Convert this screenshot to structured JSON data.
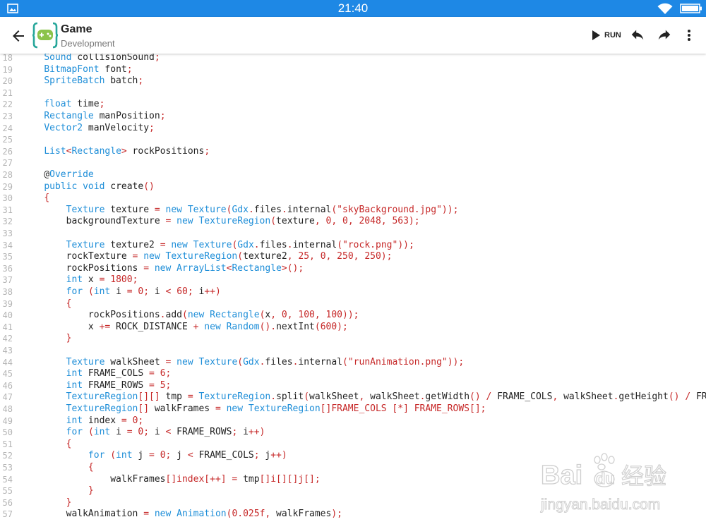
{
  "status_bar": {
    "time": "21:40",
    "color": "#1e88e5"
  },
  "app_bar": {
    "title": "Game",
    "subtitle": "Development",
    "run_label": "RUN",
    "icons": [
      "back-arrow-icon",
      "app-logo-icon",
      "play-icon",
      "undo-icon",
      "redo-icon",
      "more-vert-icon"
    ]
  },
  "colors": {
    "keyword": "#1e8ed8",
    "string": "#c62828",
    "number": "#c62828",
    "line_number": "#b4b4b4",
    "text": "#222222"
  },
  "editor": {
    "lines": [
      {
        "n": "18",
        "t": "    {Sound} collisionSound[;]"
      },
      {
        "n": "19",
        "t": "    {BitmapFont} font[;]"
      },
      {
        "n": "20",
        "t": "    {SpriteBatch} batch[;]"
      },
      {
        "n": "21",
        "t": ""
      },
      {
        "n": "22",
        "t": "    {float} time[;]"
      },
      {
        "n": "23",
        "t": "    {Rectangle} manPosition[;]"
      },
      {
        "n": "24",
        "t": "    {Vector2} manVelocity[;]"
      },
      {
        "n": "25",
        "t": ""
      },
      {
        "n": "26",
        "t": "    {List}[<]{Rectangle}[>] rockPositions[;]"
      },
      {
        "n": "27",
        "t": ""
      },
      {
        "n": "28",
        "t": "    @{Override}"
      },
      {
        "n": "29",
        "t": "    {public} {void} create[()]"
      },
      {
        "n": "30",
        "t": "    [{]"
      },
      {
        "n": "31",
        "t": "        {Texture} texture [=] {new} {Texture}[(]{Gdx}[.]files[.]internal[(]\"skyBackground.jpg\"[));]"
      },
      {
        "n": "32",
        "t": "        backgroundTexture [=] {new} {TextureRegion}[(]texture[,] <0>[,] <0>[,] <2048>[,] <563>[);]"
      },
      {
        "n": "33",
        "t": ""
      },
      {
        "n": "34",
        "t": "        {Texture} texture2 [=] {new} {Texture}[(]{Gdx}[.]files[.]internal[(]\"rock.png\"[));]"
      },
      {
        "n": "35",
        "t": "        rockTexture [=] {new} {TextureRegion}[(]texture2[,] <25>[,] <0>[,] <250>[,] <250>[);]"
      },
      {
        "n": "36",
        "t": "        rockPositions [=] {new} {ArrayList}[<]{Rectangle}[>();]"
      },
      {
        "n": "37",
        "t": "        {int} x [=] <1800>[;]"
      },
      {
        "n": "38",
        "t": "        {for} [(]{int} i [=] <0>[;] i [<] <60>[;] i[++)]"
      },
      {
        "n": "39",
        "t": "        [{]"
      },
      {
        "n": "40",
        "t": "            rockPositions[.]add[(]{new} {Rectangle}[(]x[,] <0>[,] <100>[,] <100>[));]"
      },
      {
        "n": "41",
        "t": "            x [+=] ROCK_DISTANCE [+] {new} {Random}[().]nextInt[(]<600>[);]"
      },
      {
        "n": "42",
        "t": "        [}]"
      },
      {
        "n": "43",
        "t": ""
      },
      {
        "n": "44",
        "t": "        {Texture} walkSheet [=] {new} {Texture}[(]{Gdx}[.]files[.]internal[(]\"runAnimation.png\"[));]"
      },
      {
        "n": "45",
        "t": "        {int} FRAME_COLS [=] <6>[;]"
      },
      {
        "n": "46",
        "t": "        {int} FRAME_ROWS [=] <5>[;]"
      },
      {
        "n": "47",
        "t": "        {TextureRegion}[[][]] tmp [=] {TextureRegion}[.]split[(]walkSheet[,] walkSheet[.]getWidth[()] [/] FRAME_COLS[,] walkSheet[.]getHeight[()] [/] FRAME_ROWS[);]"
      },
      {
        "n": "48",
        "t": "        {TextureRegion}[[]] walkFrames [=] {new} {TextureRegion}[[]FRAME_COLS [*] FRAME_ROWS[];]"
      },
      {
        "n": "49",
        "t": "        {int} index [=] <0>[;]"
      },
      {
        "n": "50",
        "t": "        {for} [(]{int} i [=] <0>[;] i [<] FRAME_ROWS[;] i[++)]"
      },
      {
        "n": "51",
        "t": "        [{]"
      },
      {
        "n": "52",
        "t": "            {for} [(]{int} j [=] <0>[;] j [<] FRAME_COLS[;] j[++)]"
      },
      {
        "n": "53",
        "t": "            [{]"
      },
      {
        "n": "54",
        "t": "                walkFrames[[]index[++]] [=] tmp[[]i[][]j[];]"
      },
      {
        "n": "55",
        "t": "            [}]"
      },
      {
        "n": "56",
        "t": "        [}]"
      },
      {
        "n": "57",
        "t": "        walkAnimation [=] {new} {Animation}[(]<0.025f>[,] walkFrames[);]"
      }
    ]
  },
  "watermark": {
    "brand": "Bai",
    "brand_suffix": "du",
    "product": "经验",
    "url": "jingyan.baidu.com"
  }
}
